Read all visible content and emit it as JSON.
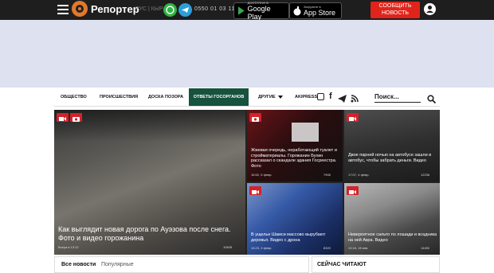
{
  "header": {
    "logo_text": "Репортер",
    "lang": "РУС | КЫР",
    "phone": "0550 01 03 11",
    "google_small": "ДОСТУПНО В",
    "google_big": "Google Play",
    "apple_small": "Загрузите в",
    "apple_big": "App Store",
    "report_line1": "СООБЩИТЬ",
    "report_line2": "НОВОСТЬ"
  },
  "nav": {
    "items": [
      "Общество",
      "Происшествия",
      "Доска позора",
      "Ответы госорганов",
      "Другие",
      "AKIpress"
    ],
    "search_placeholder": "Поиск..."
  },
  "tiles": {
    "main": {
      "title": "Как выглядит новая дорога по Ауэзова после снега. Фото и видео горожанина",
      "time": "Вчера в 13:12",
      "views": "10828"
    },
    "t1": {
      "title": "Жжевая очередь, неработающий туалет и стройматериалы. Горожанин Бухин рассказал о скандале здания Госреестра. Фото",
      "time": "16:52, 5 февр.",
      "views": "7906"
    },
    "t2": {
      "title": "Двое парней ночью на автобусе зашли в автобус, чтобы забрать деньги. Видео",
      "time": "17:07, 4 февр.",
      "views": "12236"
    },
    "t3": {
      "title": "В ущелье Шамси массово вырубают деревья. Видео с дрона",
      "time": "15:23, 3 февр.",
      "views": "8320"
    },
    "t4": {
      "title": "Невероятное сальто по лошади и всадника на ней Акра. Видео",
      "time": "13:18, 28 янв.",
      "views": "14492"
    }
  },
  "bottom": {
    "tab_all": "Все новости",
    "tab_popular": "Популярные",
    "reading_now": "Сейчас читают"
  },
  "colors": {
    "accent_red": "#e0241b",
    "nav_active": "#16523d",
    "banner": "#dee1f0"
  }
}
